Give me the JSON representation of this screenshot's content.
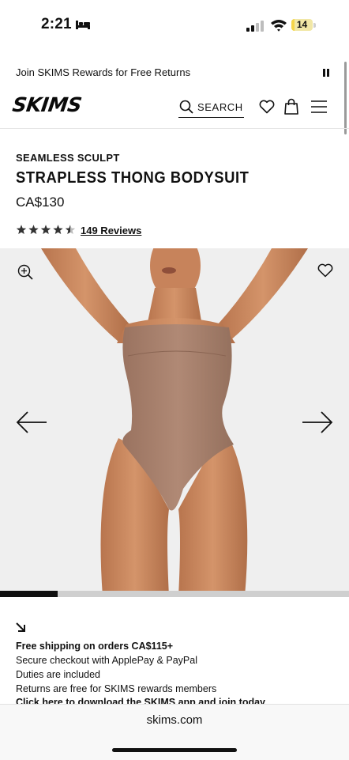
{
  "status_bar": {
    "time": "2:21",
    "battery": "14",
    "battery_level": 0.14
  },
  "promo": {
    "text": "Join SKIMS Rewards for Free Returns"
  },
  "header": {
    "logo": "SKIMS",
    "search_label": "SEARCH"
  },
  "product": {
    "collection": "SEAMLESS SCULPT",
    "title": "STRAPLESS THONG BODYSUIT",
    "price": "CA$130",
    "rating": 4.5,
    "reviews": "149 Reviews"
  },
  "gallery": {
    "progress": 0.165
  },
  "details": {
    "shipping": "Free shipping on orders CA$115+",
    "checkout": "Secure checkout with ApplePay & PayPal",
    "duties": "Duties are included",
    "returns": "Returns are free for SKIMS rewards members",
    "app_link": "Click here to download the SKIMS app and join today"
  },
  "browser": {
    "url": "skims.com"
  },
  "colors": {
    "accent": "#111111",
    "image_bg": "#efefef",
    "skin": "#c9875e",
    "bodysuit": "#a67f69"
  }
}
